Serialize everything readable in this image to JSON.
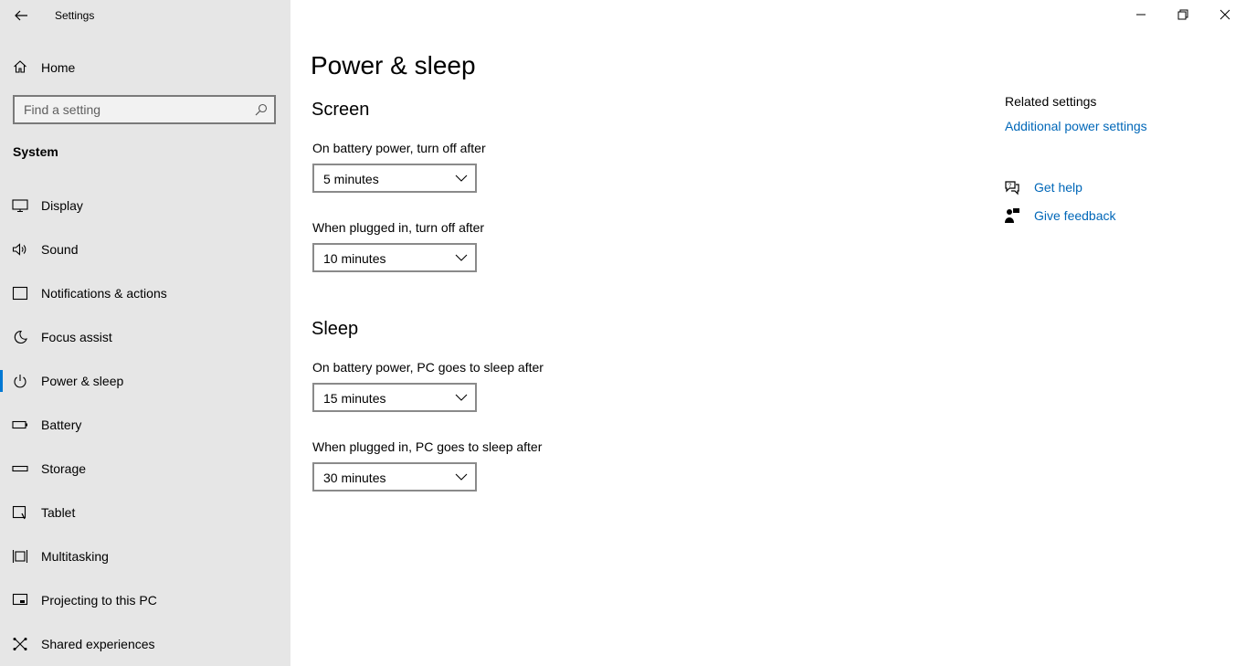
{
  "app": {
    "title": "Settings"
  },
  "sidebar": {
    "home_label": "Home",
    "search_placeholder": "Find a setting",
    "section_title": "System",
    "items": [
      {
        "label": "Display",
        "icon": "monitor-icon"
      },
      {
        "label": "Sound",
        "icon": "speaker-icon"
      },
      {
        "label": "Notifications & actions",
        "icon": "notification-icon"
      },
      {
        "label": "Focus assist",
        "icon": "moon-icon"
      },
      {
        "label": "Power & sleep",
        "icon": "power-icon",
        "active": true
      },
      {
        "label": "Battery",
        "icon": "battery-icon"
      },
      {
        "label": "Storage",
        "icon": "storage-icon"
      },
      {
        "label": "Tablet",
        "icon": "tablet-icon"
      },
      {
        "label": "Multitasking",
        "icon": "multitasking-icon"
      },
      {
        "label": "Projecting to this PC",
        "icon": "projector-icon"
      },
      {
        "label": "Shared experiences",
        "icon": "shared-icon"
      }
    ]
  },
  "main": {
    "title": "Power & sleep",
    "screen": {
      "title": "Screen",
      "battery_label": "On battery power, turn off after",
      "battery_value": "5 minutes",
      "plugged_label": "When plugged in, turn off after",
      "plugged_value": "10 minutes"
    },
    "sleep": {
      "title": "Sleep",
      "battery_label": "On battery power, PC goes to sleep after",
      "battery_value": "15 minutes",
      "plugged_label": "When plugged in, PC goes to sleep after",
      "plugged_value": "30 minutes"
    }
  },
  "related": {
    "title": "Related settings",
    "additional_power": "Additional power settings",
    "get_help": "Get help",
    "give_feedback": "Give feedback"
  },
  "colors": {
    "accent": "#0078d4",
    "link": "#0067b8",
    "sidebar_bg": "#e6e6e6"
  }
}
